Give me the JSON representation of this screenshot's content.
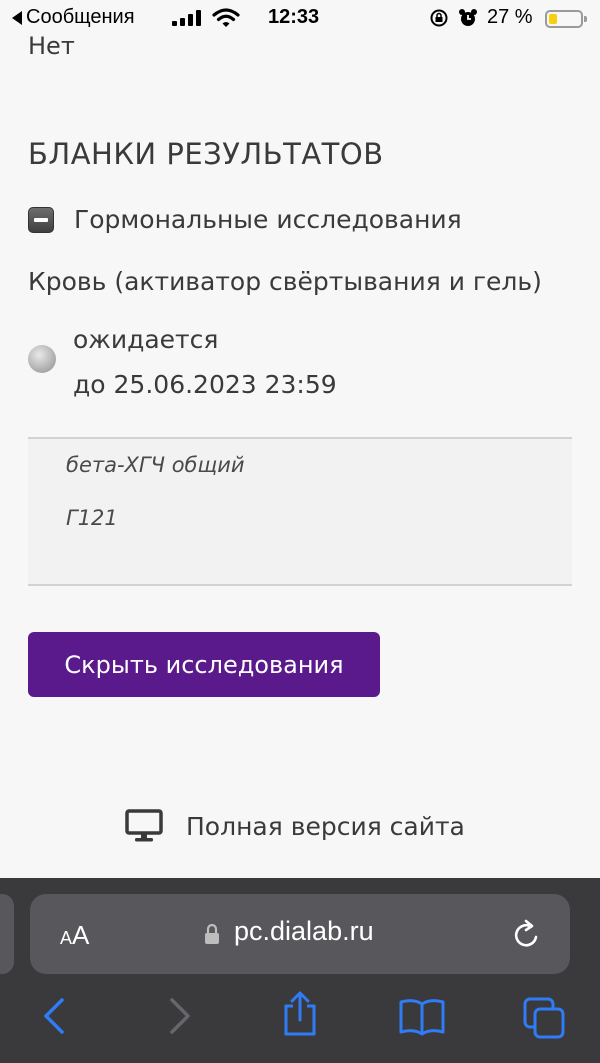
{
  "status_bar": {
    "back_app": "Сообщения",
    "time": "12:33",
    "battery_pct": "27 %",
    "battery_level": 0.27,
    "icons": [
      "signal-icon",
      "wifi-icon",
      "orientation-lock-icon",
      "alarm-icon",
      "battery-icon"
    ]
  },
  "content": {
    "previous_value": "Нет",
    "section_title": "БЛАНКИ РЕЗУЛЬТАТОВ",
    "group_label": "Гормональные исследования",
    "sample_label": "Кровь (активатор свёртывания и гель)",
    "status_label": "ожидается",
    "due_label": "до 25.06.2023 23:59",
    "test_name": "бета-ХГЧ общий",
    "test_code": "Г121",
    "hide_button": "Скрыть исследования",
    "full_site_link": "Полная версия сайта"
  },
  "browser": {
    "text_size_small": "A",
    "text_size_big": "A",
    "url": "pc.dialab.ru"
  },
  "colors": {
    "accent": "#5b1a8c",
    "page_bg": "#f7f7f7",
    "toolbar_bg": "#3a3a3c",
    "toolbar_icon": "#2f7cf6"
  }
}
